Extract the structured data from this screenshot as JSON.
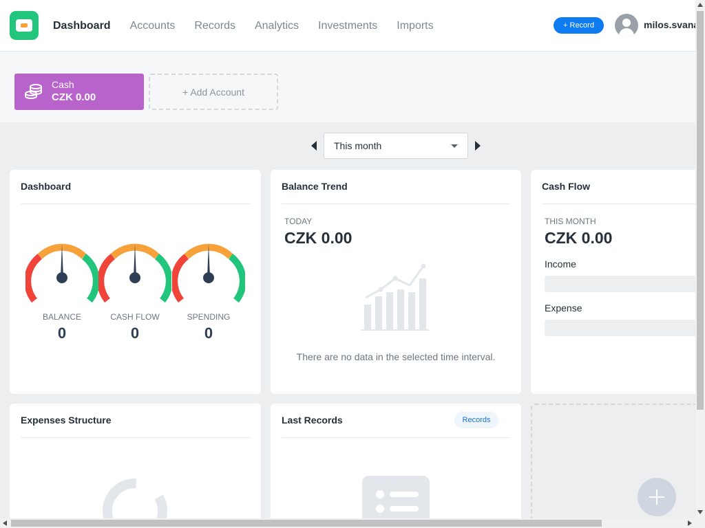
{
  "header": {
    "logo_icon": "wallet-icon",
    "nav": [
      {
        "label": "Dashboard",
        "active": true
      },
      {
        "label": "Accounts"
      },
      {
        "label": "Records"
      },
      {
        "label": "Analytics"
      },
      {
        "label": "Investments"
      },
      {
        "label": "Imports"
      }
    ],
    "record_button": "+ Record",
    "username": "milos.svana"
  },
  "accounts": {
    "items": [
      {
        "name": "Cash",
        "balance": "CZK 0.00",
        "color": "#b863cc",
        "icon": "coins-icon"
      }
    ],
    "add_label": "+ Add Account"
  },
  "period": {
    "selected": "This month"
  },
  "dashboard": {
    "title": "Dashboard",
    "gauges": [
      {
        "label": "BALANCE",
        "value": "0"
      },
      {
        "label": "CASH FLOW",
        "value": "0"
      },
      {
        "label": "SPENDING",
        "value": "0"
      }
    ]
  },
  "balance_trend": {
    "title": "Balance Trend",
    "caption": "TODAY",
    "amount": "CZK 0.00",
    "empty": "There are no data in the selected time interval."
  },
  "cash_flow": {
    "title": "Cash Flow",
    "caption": "THIS MONTH",
    "amount": "CZK 0.00",
    "income_label": "Income",
    "expense_label": "Expense"
  },
  "expenses_structure": {
    "title": "Expenses Structure"
  },
  "last_records": {
    "title": "Last Records",
    "link": "Records"
  },
  "colors": {
    "accent": "#0f7bf0",
    "brand": "#21c57b",
    "cash_account": "#b863cc"
  }
}
